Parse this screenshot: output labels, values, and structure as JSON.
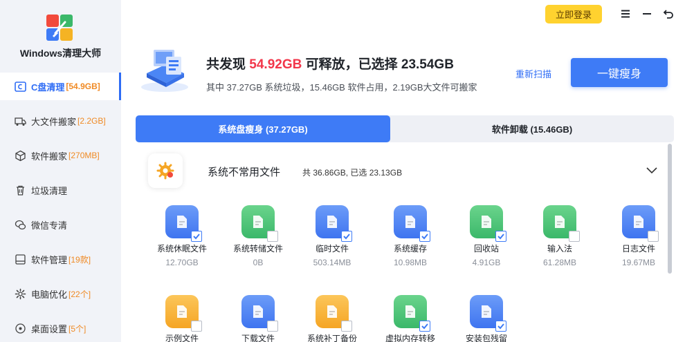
{
  "app": {
    "title": "Windows清理大师"
  },
  "topbar": {
    "login_label": "立即登录"
  },
  "sidebar": {
    "items": [
      {
        "label": "C盘清理",
        "badge": "[54.9GB]",
        "icon": "c-drive-icon",
        "active": true
      },
      {
        "label": "大文件搬家",
        "badge": "[2.2GB]",
        "icon": "truck-icon"
      },
      {
        "label": "软件搬家",
        "badge": "[270MB]",
        "icon": "box-icon"
      },
      {
        "label": "垃圾清理",
        "badge": "",
        "icon": "trash-icon"
      },
      {
        "label": "微信专清",
        "badge": "",
        "icon": "wechat-icon"
      },
      {
        "label": "软件管理",
        "badge": "[19款]",
        "icon": "monitor-icon"
      },
      {
        "label": "电脑优化",
        "badge": "[22个]",
        "icon": "gear-icon"
      },
      {
        "label": "桌面设置",
        "badge": "[5个]",
        "icon": "desktop-icon"
      }
    ]
  },
  "summary": {
    "title_prefix": "共发现 ",
    "found_size": "54.92GB",
    "title_middle": " 可释放，已选择 ",
    "selected_size": "23.54GB",
    "subtitle": "其中 37.27GB 系统垃圾，15.46GB 软件占用，2.19GB大文件可搬家",
    "rescan_label": "重新扫描",
    "slim_label": "一键瘦身"
  },
  "tabs": [
    {
      "label": "系统盘瘦身 (37.27GB)",
      "active": true
    },
    {
      "label": "软件卸载 (15.46GB)",
      "active": false
    }
  ],
  "section": {
    "title": "系统不常用文件",
    "stat": "共 36.86GB, 已选 23.13GB"
  },
  "items": [
    {
      "label": "系统休眠文件",
      "size": "12.70GB",
      "color": "blue",
      "checked": true,
      "icon": "hibernate-file-icon"
    },
    {
      "label": "系统转储文件",
      "size": "0B",
      "color": "green",
      "checked": false,
      "icon": "dump-file-icon"
    },
    {
      "label": "临时文件",
      "size": "503.14MB",
      "color": "blue",
      "checked": true,
      "icon": "temp-file-icon"
    },
    {
      "label": "系统缓存",
      "size": "10.98MB",
      "color": "blue",
      "checked": true,
      "icon": "cache-icon"
    },
    {
      "label": "回收站",
      "size": "4.91GB",
      "color": "green",
      "checked": true,
      "icon": "recycle-bin-icon"
    },
    {
      "label": "输入法",
      "size": "61.28MB",
      "color": "green",
      "checked": false,
      "icon": "keyboard-icon"
    },
    {
      "label": "日志文件",
      "size": "19.67MB",
      "color": "blue",
      "checked": false,
      "icon": "log-file-icon"
    },
    {
      "label": "示例文件",
      "size": "",
      "color": "orange",
      "checked": false,
      "icon": "sample-folder-icon"
    },
    {
      "label": "下载文件",
      "size": "",
      "color": "blue",
      "checked": false,
      "icon": "download-folder-icon"
    },
    {
      "label": "系统补丁备份",
      "size": "",
      "color": "orange",
      "checked": false,
      "icon": "patch-backup-icon"
    },
    {
      "label": "虚拟内存转移",
      "size": "",
      "color": "green",
      "checked": true,
      "icon": "virtual-memory-icon"
    },
    {
      "label": "安装包残留",
      "size": "",
      "color": "blue",
      "checked": true,
      "icon": "installer-icon"
    }
  ]
}
